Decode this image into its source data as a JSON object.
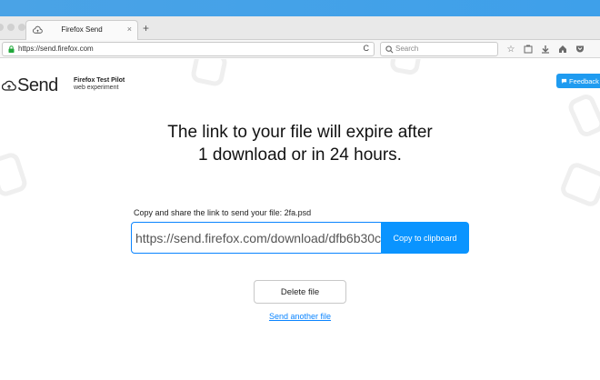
{
  "browser": {
    "tab_title": "Firefox Send",
    "tab_close": "×",
    "new_tab": "+",
    "url": "https://send.firefox.com",
    "reload": "C",
    "search_placeholder": "Search"
  },
  "header": {
    "logo_text": "Send",
    "pilot_title": "Firefox Test Pilot",
    "pilot_subtitle": "web experiment",
    "feedback_label": "Feedback"
  },
  "main": {
    "headline_line1": "The link to your file will expire after",
    "headline_line2": "1 download or in 24 hours.",
    "share_label": "Copy and share the link to send your file: 2fa.psd",
    "share_link": "https://send.firefox.com/download/dfb6b30c",
    "copy_label": "Copy to clipboard",
    "delete_label": "Delete file",
    "send_another_label": "Send another file"
  },
  "colors": {
    "accent": "#0a84ff",
    "feedback": "#1f9bf0",
    "top_band": "#4aa3e6",
    "secure_lock": "#22a83c"
  }
}
